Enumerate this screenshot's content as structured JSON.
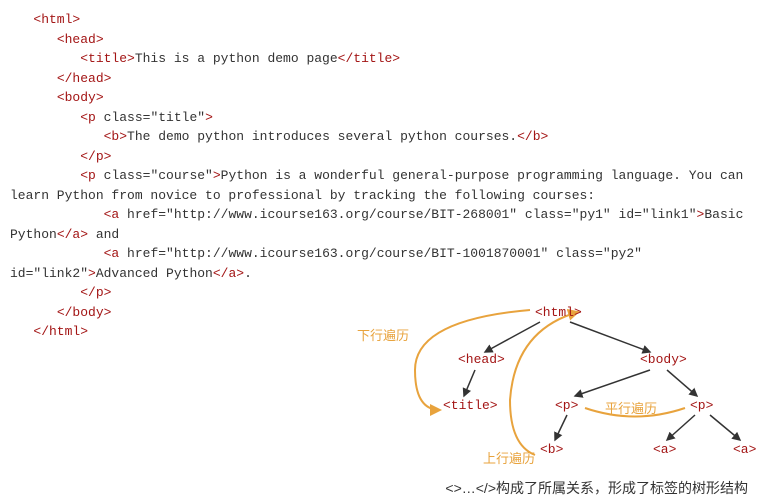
{
  "code": {
    "open_html": "<html>",
    "open_head": "<head>",
    "open_title": "<title>",
    "title_text": "This is a python demo page",
    "close_title": "</title>",
    "close_head": "</head>",
    "open_body": "<body>",
    "p1_open": "<p",
    "p1_attr": "class=\"title\"",
    "close_angle": ">",
    "b_open": "<b>",
    "b_text": "The demo python introduces several python courses.",
    "b_close": "</b>",
    "close_p": "</p>",
    "p2_open": "<p",
    "p2_attr": "class=\"course\"",
    "p2_text": "Python is a wonderful general-purpose programming language. You can learn Python from novice to professional by tracking the following courses:",
    "a1_open": "<a",
    "a1_attr": "href=\"http://www.icourse163.org/course/BIT-268001\" class=\"py1\" id=\"link1\"",
    "a1_text": "Basic Python",
    "a_close": "</a>",
    "and_text": " and",
    "a2_open": "<a",
    "a2_attr": "href=\"http://www.icourse163.org/course/BIT-1001870001\" class=\"py2\" id=\"link2\"",
    "a2_text": "Advanced Python",
    "period": ".",
    "close_body": "</body>",
    "close_html": "</html>"
  },
  "tree": {
    "html": "<html>",
    "head": "<head>",
    "title": "<title>",
    "body": "<body>",
    "p": "<p>",
    "b": "<b>",
    "a": "<a>"
  },
  "labels": {
    "down": "下行遍历",
    "up": "上行遍历",
    "side": "平行遍历"
  },
  "caption": "<>…</>构成了所属关系，形成了标签的树形结构"
}
